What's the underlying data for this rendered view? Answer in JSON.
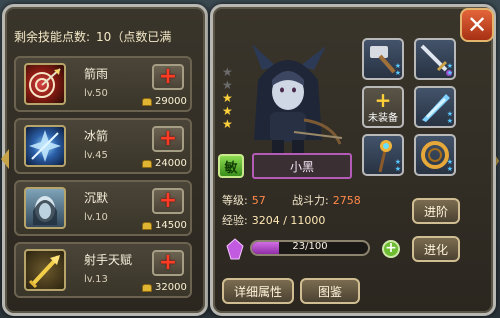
{
  "skills_panel": {
    "remaining_label": "剩余技能点数:",
    "remaining_value": "10（点数已满",
    "skills": [
      {
        "name": "箭雨",
        "level": "lv.50",
        "cost": "29000"
      },
      {
        "name": "冰箭",
        "level": "lv.45",
        "cost": "24000"
      },
      {
        "name": "沉默",
        "level": "lv.10",
        "cost": "14500"
      },
      {
        "name": "射手天赋",
        "level": "lv.13",
        "cost": "32000"
      }
    ],
    "plus_symbol": "+"
  },
  "hero_panel": {
    "rank_badge": "敏",
    "name": "小黑",
    "stars": {
      "total": 5,
      "filled": 3
    },
    "level_label": "等级:",
    "level_value": "57",
    "power_label": "战斗力:",
    "power_value": "2758",
    "exp_label": "经验:",
    "exp_value": "3204 / 11000",
    "exp_fraction": 0.291,
    "shard_progress": "23/100",
    "shard_fraction": 0.23,
    "advance_button": "进阶",
    "evolve_button": "进化",
    "details_button": "详细属性",
    "codex_button": "图鉴",
    "close_symbol": "✕",
    "unequipped_label": "未装备",
    "add_symbol": "+"
  },
  "colors": {
    "accent_orange": "#ff8a4a",
    "exp_purple": "#d16ee5",
    "rank_green": "#6dbd32",
    "plus_red": "#ff3b23"
  }
}
